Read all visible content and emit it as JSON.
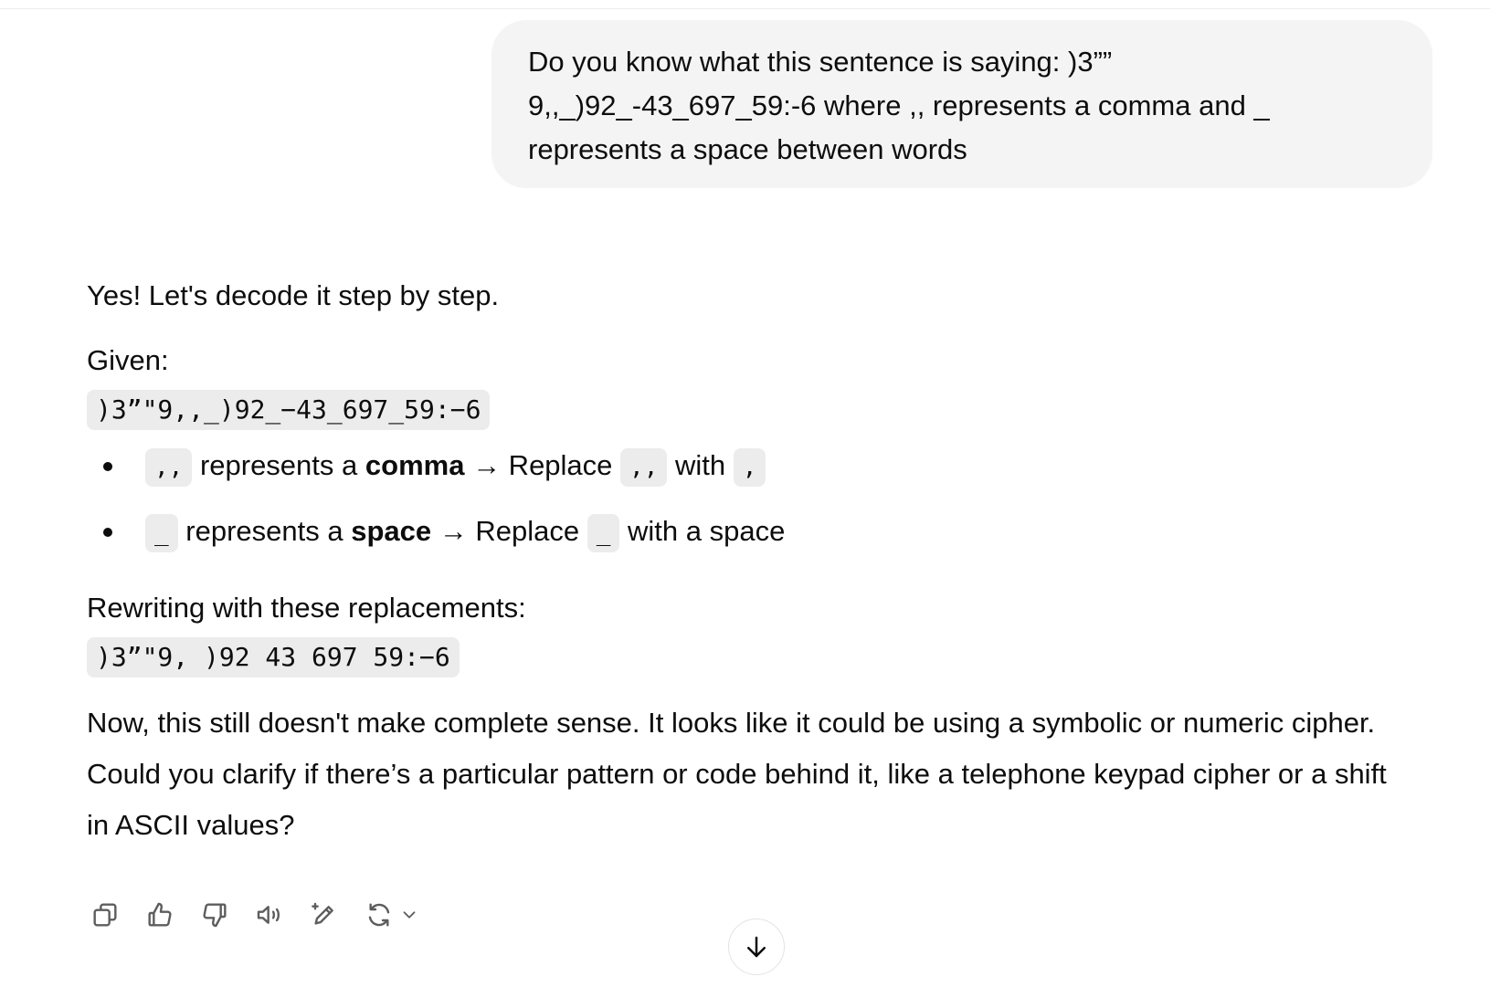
{
  "user_message": {
    "text": "Do you know what this sentence is saying: )3””\n9,,_)92_-43_697_59:-6 where ,, represents a comma and _\nrepresents a space between words"
  },
  "assistant_message": {
    "intro": "Yes! Let's decode it step by step.",
    "given_label": "Given:",
    "given_code": ")3”\"9,,_)92_−43_697_59:−6",
    "rules": [
      {
        "code1": ",,",
        "pre": "represents a",
        "bold": "comma",
        "mid": "→ Replace",
        "code2": ",,",
        "post": "with",
        "code3": ","
      },
      {
        "code1": "_",
        "pre": "represents a",
        "bold": "space",
        "mid": "→ Replace",
        "code2": "_",
        "post": "with a space"
      }
    ],
    "rewrite_label": "Rewriting with these replacements:",
    "rewrite_code": ")3”\"9, )92 43 697 59:−6",
    "closing": "Now, this still doesn't make complete sense. It looks like it could be using a symbolic or numeric cipher. Could you clarify if there’s a particular pattern or code behind it, like a telephone keypad cipher or a shift in ASCII values?"
  },
  "action_bar": {
    "icons": [
      "copy-icon",
      "thumbs-up-icon",
      "thumbs-down-icon",
      "read-aloud-icon",
      "edit-sparkle-icon",
      "regenerate-icon",
      "chevron-down-icon"
    ]
  },
  "scroll_button": {
    "icon": "arrow-down-icon"
  }
}
